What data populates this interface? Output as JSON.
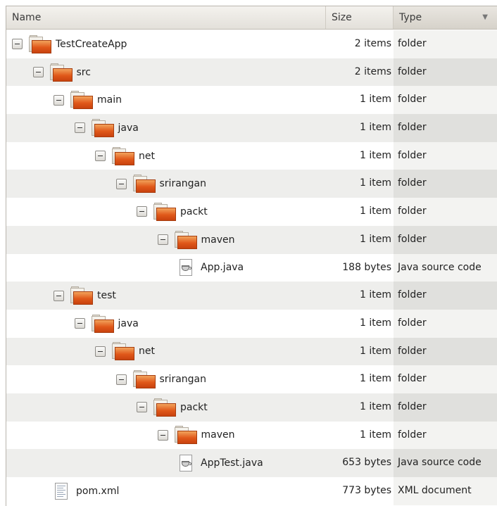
{
  "columns": {
    "name": "Name",
    "size": "Size",
    "type": "Type",
    "sort_indicator": "▼"
  },
  "rows": [
    {
      "name": "TestCreateApp",
      "size": "2 items",
      "type": "folder",
      "depth": 0,
      "icon": "folder-icon",
      "expanded": true
    },
    {
      "name": "src",
      "size": "2 items",
      "type": "folder",
      "depth": 1,
      "icon": "folder-icon",
      "expanded": true
    },
    {
      "name": "main",
      "size": "1 item",
      "type": "folder",
      "depth": 2,
      "icon": "folder-icon",
      "expanded": true
    },
    {
      "name": "java",
      "size": "1 item",
      "type": "folder",
      "depth": 3,
      "icon": "folder-icon",
      "expanded": true
    },
    {
      "name": "net",
      "size": "1 item",
      "type": "folder",
      "depth": 4,
      "icon": "folder-icon",
      "expanded": true
    },
    {
      "name": "srirangan",
      "size": "1 item",
      "type": "folder",
      "depth": 5,
      "icon": "folder-icon",
      "expanded": true
    },
    {
      "name": "packt",
      "size": "1 item",
      "type": "folder",
      "depth": 6,
      "icon": "folder-icon",
      "expanded": true
    },
    {
      "name": "maven",
      "size": "1 item",
      "type": "folder",
      "depth": 7,
      "icon": "folder-icon",
      "expanded": true
    },
    {
      "name": "App.java",
      "size": "188 bytes",
      "type": "Java source code",
      "depth": 8,
      "icon": "java-file-icon",
      "expanded": false
    },
    {
      "name": "test",
      "size": "1 item",
      "type": "folder",
      "depth": 2,
      "icon": "folder-icon",
      "expanded": true
    },
    {
      "name": "java",
      "size": "1 item",
      "type": "folder",
      "depth": 3,
      "icon": "folder-icon",
      "expanded": true
    },
    {
      "name": "net",
      "size": "1 item",
      "type": "folder",
      "depth": 4,
      "icon": "folder-icon",
      "expanded": true
    },
    {
      "name": "srirangan",
      "size": "1 item",
      "type": "folder",
      "depth": 5,
      "icon": "folder-icon",
      "expanded": true
    },
    {
      "name": "packt",
      "size": "1 item",
      "type": "folder",
      "depth": 6,
      "icon": "folder-icon",
      "expanded": true
    },
    {
      "name": "maven",
      "size": "1 item",
      "type": "folder",
      "depth": 7,
      "icon": "folder-icon",
      "expanded": true
    },
    {
      "name": "AppTest.java",
      "size": "653 bytes",
      "type": "Java source code",
      "depth": 8,
      "icon": "java-file-icon",
      "expanded": false
    },
    {
      "name": "pom.xml",
      "size": "773 bytes",
      "type": "XML document",
      "depth": 2,
      "icon": "xml-file-icon",
      "expanded": false
    }
  ]
}
